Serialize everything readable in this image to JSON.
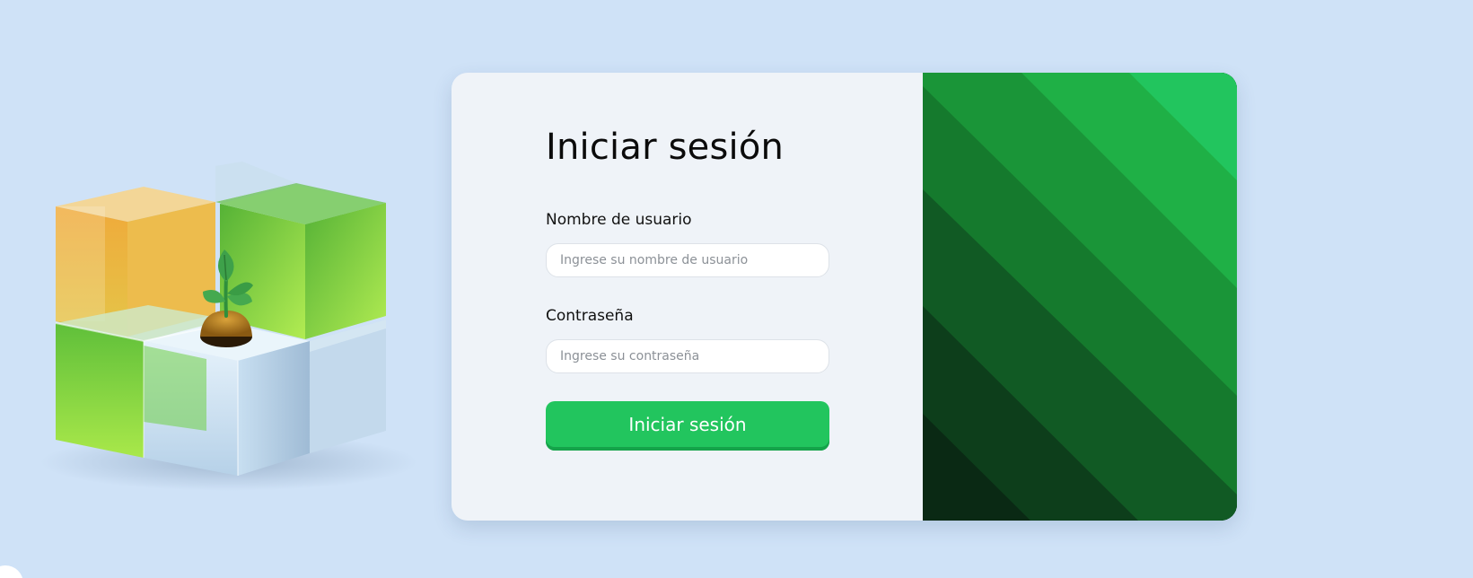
{
  "login": {
    "title": "Iniciar sesión",
    "username": {
      "label": "Nombre de usuario",
      "placeholder": "Ingrese su nombre de usuario",
      "value": ""
    },
    "password": {
      "label": "Contraseña",
      "placeholder": "Ingrese su contraseña",
      "value": ""
    },
    "submit_label": "Iniciar sesión"
  },
  "illustration": {
    "icon": "cube-sprout-icon"
  },
  "colors": {
    "background": "#cfe2f7",
    "card": "#eff3f8",
    "accent": "#22c55e",
    "accent_dark": "#15a34a",
    "stripes": [
      "#0a2914",
      "#0d3e1b",
      "#115a24",
      "#157a2d",
      "#1a9538",
      "#1fb046",
      "#22c55e"
    ]
  }
}
